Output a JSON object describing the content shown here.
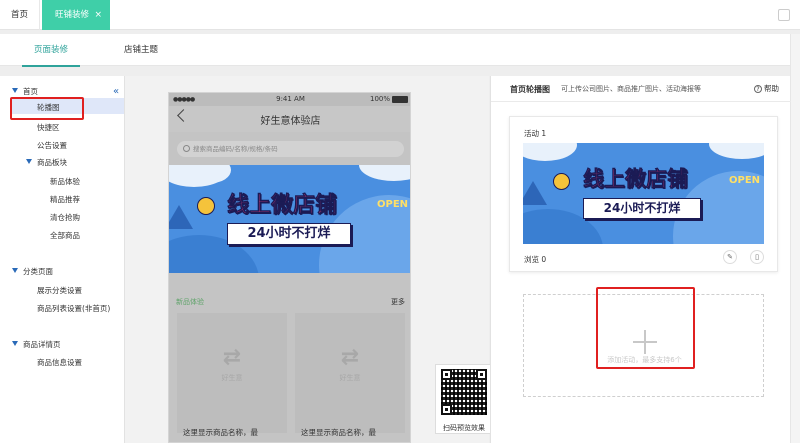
{
  "tabs": {
    "home": "首页",
    "active": "旺铺装修",
    "close": "×"
  },
  "subnav": {
    "page_decor": "页面装修",
    "shop_theme": "店铺主题"
  },
  "tree": {
    "home": "首页",
    "carousel": "轮播图",
    "quick_area": "快捷区",
    "notice": "公告设置",
    "product_section": "商品板块",
    "new_exp": "新品体验",
    "picks": "精品推荐",
    "clearance": "清仓抢购",
    "all_products": "全部商品",
    "category_page": "分类页面",
    "show_category": "展示分类设置",
    "list_settings": "商品列表设置(非首页)",
    "detail_page": "商品详情页",
    "info_settings": "商品信息设置",
    "collapse": "«"
  },
  "phone": {
    "signal": "●●●●●",
    "time": "9:41 AM",
    "battery": "100%",
    "title": "好生意体验店",
    "search_placeholder": "搜索商品编码/名称/规格/条码",
    "section_new": "新品体验",
    "section_more": "更多",
    "product_name_1": "这里显示商品名称，最",
    "product_name_2": "这里显示商品名称，最",
    "logo_text": "好生意"
  },
  "banner": {
    "title": "线上微店铺",
    "subtitle": "24小时不打烊",
    "tag": "OPEN"
  },
  "qr": {
    "label": "扫码预览效果"
  },
  "right": {
    "title": "首页轮播图",
    "hint": "可上传公司图片、商品推广图片、活动海报等",
    "help": "帮助",
    "card_title": "活动 1",
    "views": "浏览 0",
    "add_text": "添加活动，最多支持6个"
  },
  "colors": {
    "accent": "#3fcfa8",
    "link": "#2fa39b",
    "highlight_box": "#e02020",
    "banner_bg": "#4a8fe0",
    "banner_title": "#f0407a"
  }
}
